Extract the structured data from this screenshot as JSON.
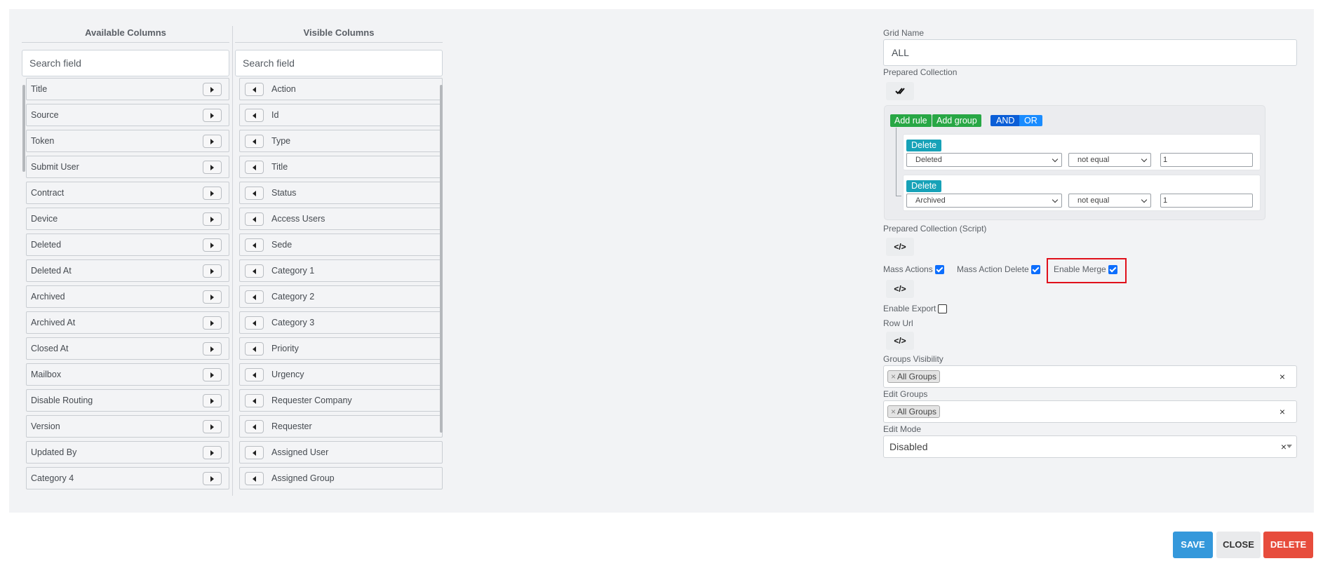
{
  "available_columns": {
    "title": "Available Columns",
    "search_placeholder": "Search field",
    "items": [
      "Title",
      "Source",
      "Token",
      "Submit User",
      "Contract",
      "Device",
      "Deleted",
      "Deleted At",
      "Archived",
      "Archived At",
      "Closed At",
      "Mailbox",
      "Disable Routing",
      "Version",
      "Updated By",
      "Category 4"
    ]
  },
  "visible_columns": {
    "title": "Visible Columns",
    "search_placeholder": "Search field",
    "items": [
      "Action",
      "Id",
      "Type",
      "Title",
      "Status",
      "Access Users",
      "Sede",
      "Category 1",
      "Category 2",
      "Category 3",
      "Priority",
      "Urgency",
      "Requester Company",
      "Requester",
      "Assigned User",
      "Assigned Group"
    ]
  },
  "form": {
    "grid_name_label": "Grid Name",
    "grid_name_value": "ALL",
    "prepared_collection_label": "Prepared Collection",
    "query_builder": {
      "add_rule": "Add rule",
      "add_group": "Add group",
      "and": "AND",
      "or": "OR",
      "rules": [
        {
          "delete": "Delete",
          "field": "Deleted",
          "operator": "not equal",
          "value": "1"
        },
        {
          "delete": "Delete",
          "field": "Archived",
          "operator": "not equal",
          "value": "1"
        }
      ]
    },
    "prepared_collection_script_label": "Prepared Collection (Script)",
    "code_icon_text": "</>",
    "mass_actions_label": "Mass Actions",
    "mass_actions_checked": true,
    "mass_action_delete_label": "Mass Action Delete",
    "mass_action_delete_checked": true,
    "enable_merge_label": "Enable Merge",
    "enable_merge_checked": true,
    "enable_export_label": "Enable Export",
    "enable_export_checked": false,
    "row_url_label": "Row Url",
    "groups_visibility_label": "Groups Visibility",
    "groups_visibility_tag": "All Groups",
    "edit_groups_label": "Edit Groups",
    "edit_groups_tag": "All Groups",
    "edit_mode_label": "Edit Mode",
    "edit_mode_value": "Disabled",
    "tag_remove": "×",
    "clear": "×"
  },
  "footer": {
    "save": "SAVE",
    "close": "CLOSE",
    "delete": "DELETE"
  },
  "colors": {
    "save": "#3498db",
    "close": "#e9eaec",
    "delete": "#e74c3c",
    "highlight": "#e0101b"
  }
}
